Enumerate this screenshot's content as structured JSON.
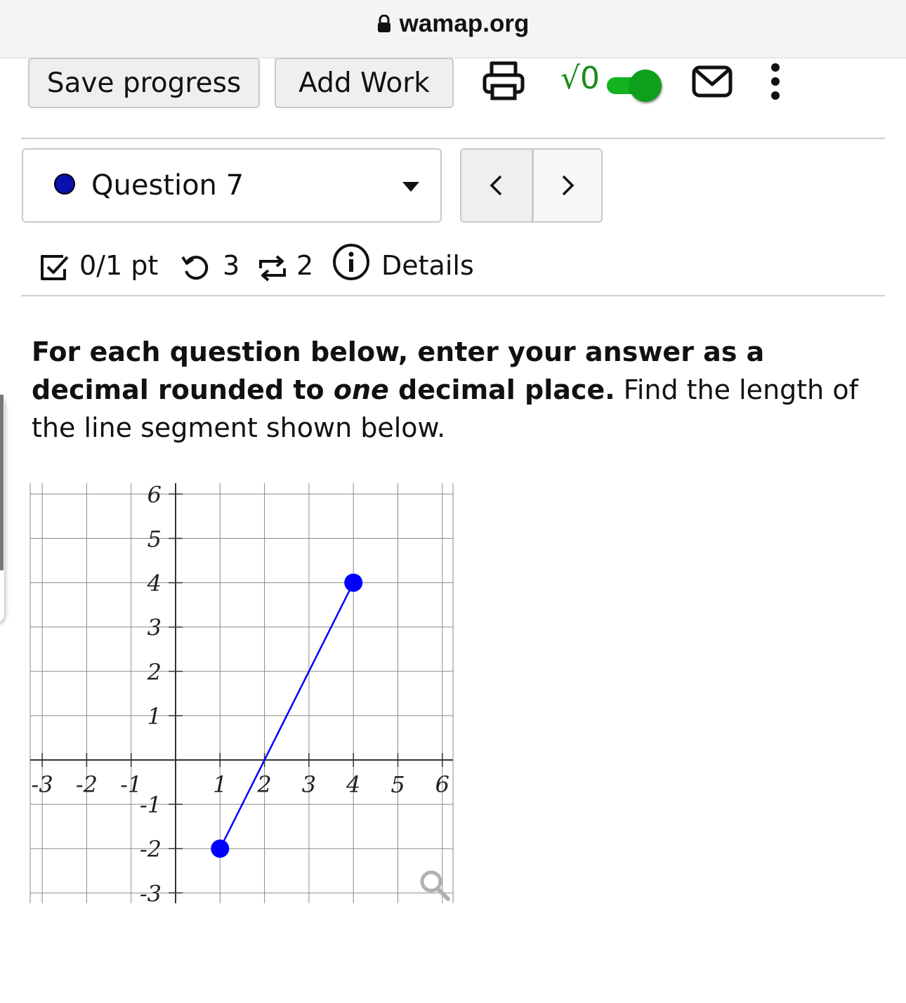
{
  "browser": {
    "url": "wamap.org"
  },
  "toolbar": {
    "save_label": "Save progress",
    "add_work_label": "Add Work",
    "math_toggle_symbol": "√0",
    "math_toggle_on": true,
    "icons": [
      "lock-icon",
      "print-icon",
      "math-entry-icon",
      "mail-icon",
      "more-vertical-icon"
    ],
    "accent_color": "#13b31f"
  },
  "question_nav": {
    "selected": "Question 7",
    "prev_symbol": "<",
    "next_symbol": ">",
    "status_dot_color": "#0a10b0"
  },
  "status_bar": {
    "score": "0/1 pt",
    "retries": "3",
    "versions": "2",
    "details": "Details"
  },
  "question": {
    "bold_part1": "For each question below, enter your answer as a decimal rounded to ",
    "bold_italic": "one",
    "bold_part2": " decimal place.",
    "text": " Find the length of the line segment shown below."
  },
  "chart_data": {
    "type": "scatter",
    "title": "",
    "xlabel": "",
    "ylabel": "",
    "xlim": [
      -3,
      6
    ],
    "ylim": [
      -3,
      6
    ],
    "grid": true,
    "x_ticks": [
      "-3",
      "-2",
      "-1",
      "1",
      "2",
      "3",
      "4",
      "5",
      "6"
    ],
    "y_ticks": [
      "6",
      "5",
      "4",
      "3",
      "2",
      "1",
      "-1",
      "-2",
      "-3"
    ],
    "series": [
      {
        "points": [
          [
            1,
            -2
          ],
          [
            4,
            4
          ]
        ],
        "color": "#0000ff",
        "connected": true
      }
    ]
  }
}
